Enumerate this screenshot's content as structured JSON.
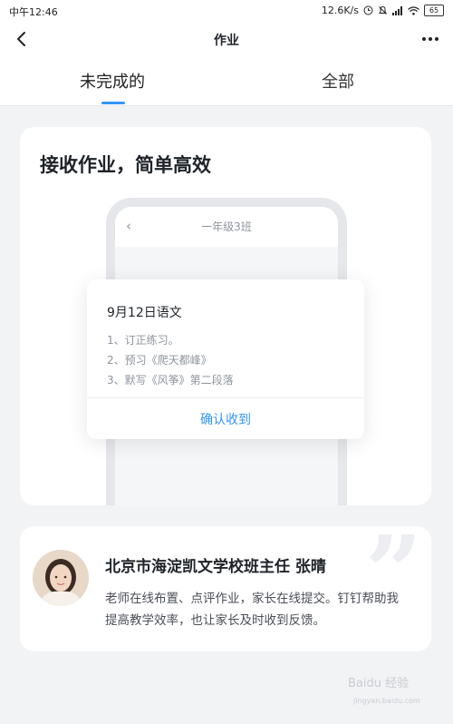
{
  "status_bar": {
    "time": "中午12:46",
    "network_speed": "12.6K/s",
    "battery": "65",
    "icons": [
      "clock-icon",
      "mute-icon",
      "signal-icon",
      "wifi-icon",
      "battery-icon"
    ]
  },
  "nav": {
    "title": "作业",
    "back_icon": "chevron-left-icon",
    "more_icon": "more-icon"
  },
  "tabs": [
    {
      "label": "未完成的",
      "active": true
    },
    {
      "label": "全部",
      "active": false
    }
  ],
  "promo_card": {
    "title": "接收作业，简单高效",
    "phone_mock": {
      "class_name": "一年级3班",
      "back_glyph": "‹"
    },
    "homework": {
      "title": "9月12日语文",
      "items": [
        "1、订正练习。",
        "2、预习《爬天都峰》",
        "3、默写《风筝》第二段落"
      ],
      "confirm_label": "确认收到"
    }
  },
  "testimonial_card": {
    "name": "北京市海淀凯文学校班主任 张晴",
    "text": "老师在线布置、点评作业，家长在线提交。钉钉帮助我提高教学效率，也让家长及时收到反馈。",
    "avatar_icon": "avatar-photo"
  },
  "watermark": {
    "text": "Baidu 经验",
    "sub": "jingyan.baidu.com"
  },
  "colors": {
    "accent": "#3296fa",
    "background": "#f2f3f5",
    "card": "#ffffff",
    "text_primary": "#1f2329",
    "text_secondary": "#8f959e"
  }
}
